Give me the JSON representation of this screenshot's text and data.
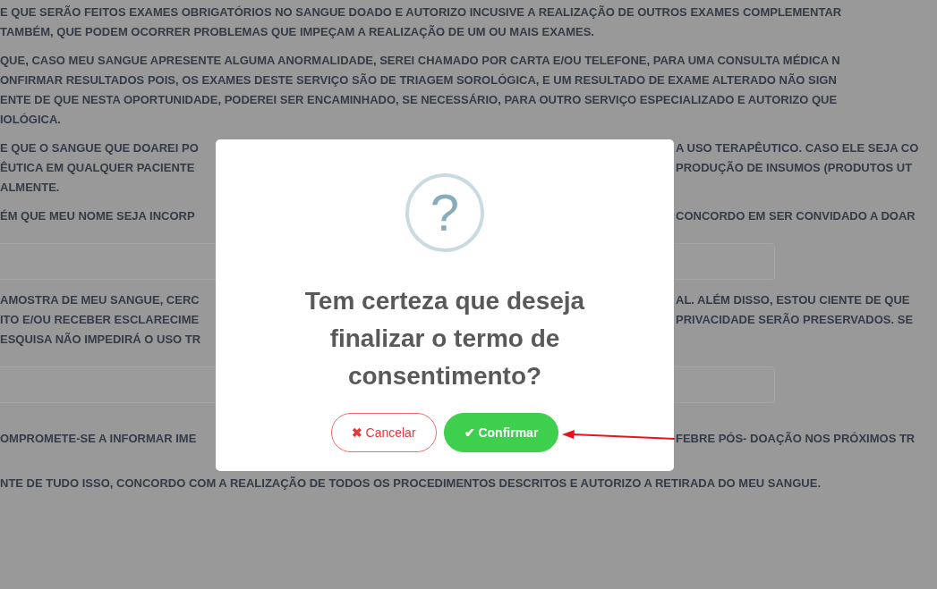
{
  "consent_text": [
    {
      "kind": "paragraph",
      "lines": [
        {
          "left": "E QUE SERÃO FEITOS EXAMES OBRIGATÓRIOS NO SANGUE DOADO E AUTORIZO INCUSIVE A REALIZAÇÃO DE OUTROS EXAMES COMPLEMENTAR"
        },
        {
          "left": "TAMBÉM, QUE PODEM OCORRER PROBLEMAS QUE IMPEÇAM A REALIZAÇÃO DE UM OU MAIS EXAMES."
        }
      ]
    },
    {
      "kind": "paragraph",
      "lines": [
        {
          "left": "QUE, CASO MEU SANGUE APRESENTE ALGUMA ANORMALIDADE, SEREI CHAMADO POR CARTA E/OU TELEFONE, PARA UMA CONSULTA MÉDICA N"
        },
        {
          "left": "ONFIRMAR RESULTADOS POIS, OS EXAMES DESTE SERVIÇO SÃO DE TRIAGEM SOROLÓGICA, E UM RESULTADO DE EXAME ALTERADO NÃO SIGN"
        },
        {
          "left": "ENTE DE QUE NESTA OPORTUNIDADE, PODEREI SER ENCAMINHADO, SE NECESSÁRIO, PARA OUTRO SERVIÇO ESPECIALIZADO E AUTORIZO QUE"
        },
        {
          "left": "IOLÓGICA."
        }
      ]
    },
    {
      "kind": "paragraph",
      "lines": [
        {
          "left": "E QUE O SANGUE QUE DOAREI PO",
          "right": "A USO TERAPÊUTICO. CASO ELE SEJA CO"
        },
        {
          "left": "ÊUTICA EM QUALQUER PACIENTE",
          "right": "PRODUÇÃO DE INSUMOS (PRODUTOS UT"
        },
        {
          "left": "ALMENTE."
        }
      ]
    },
    {
      "kind": "paragraph",
      "lines": [
        {
          "left": "ÉM QUE MEU NOME SEJA INCORP",
          "right": "CONCORDO EM SER CONVIDADO A DOAR"
        }
      ]
    },
    {
      "kind": "field"
    },
    {
      "kind": "paragraph",
      "lines": [
        {
          "left": "AMOSTRA DE MEU SANGUE, CERC",
          "right": "AL. ALÉM DISSO, ESTOU CIENTE DE QUE"
        },
        {
          "left": "ITO E/OU RECEBER ESCLARECIME",
          "right": "PRIVACIDADE SERÃO PRESERVADOS. SE"
        },
        {
          "left": "ESQUISA NÃO IMPEDIRÁ O USO TR"
        }
      ]
    },
    {
      "kind": "field"
    },
    {
      "kind": "paragraph",
      "lines": [
        {
          "left": "OMPROMETE-SE A INFORMAR IME",
          "right": "FEBRE PÓS- DOAÇÃO NOS PRÓXIMOS TR"
        }
      ]
    },
    {
      "kind": "paragraph",
      "lines": [
        {
          "left": "NTE DE TUDO ISSO, CONCORDO COM A REALIZAÇÃO DE TODOS OS PROCEDIMENTOS DESCRITOS E AUTORIZO A RETIRADA DO MEU SANGUE."
        }
      ]
    }
  ],
  "dialog": {
    "icon": "?",
    "title": "Tem certeza que deseja finalizar o termo de consentimento?",
    "buttons": [
      {
        "kind": "cancel",
        "icon": "✖",
        "label": "Cancelar"
      },
      {
        "kind": "confirm",
        "icon": "✔",
        "label": "Confirmar"
      }
    ]
  }
}
